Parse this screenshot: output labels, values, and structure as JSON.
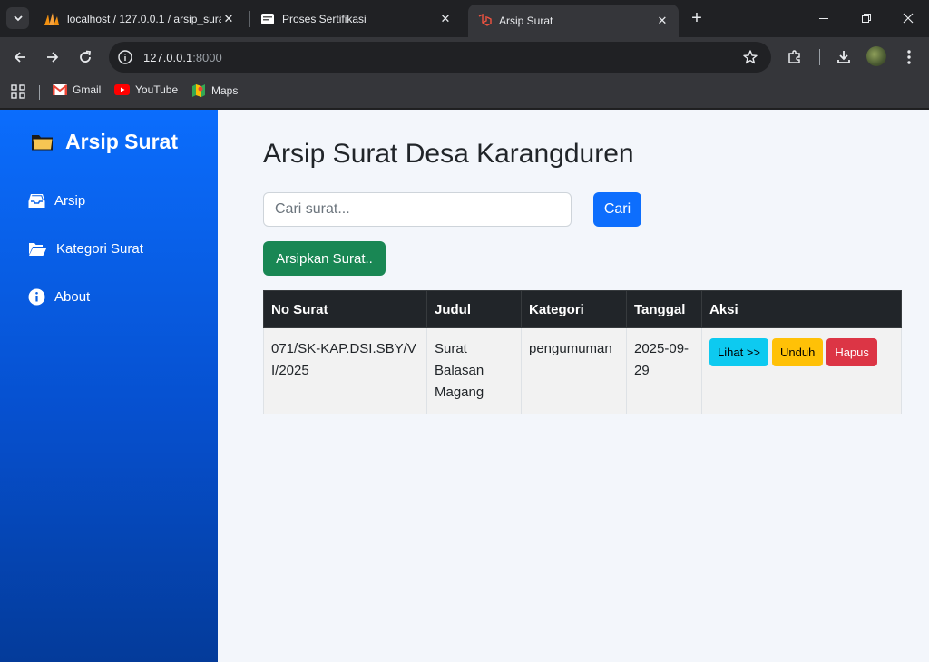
{
  "browser": {
    "tabs": [
      {
        "title": "localhost / 127.0.0.1 / arsip_surat"
      },
      {
        "title": "Proses Sertifikasi"
      },
      {
        "title": "Arsip Surat"
      }
    ],
    "url_host": "127.0.0.1",
    "url_port": ":8000",
    "bookmarks": [
      {
        "label": "Gmail"
      },
      {
        "label": "YouTube"
      },
      {
        "label": "Maps"
      }
    ]
  },
  "sidebar": {
    "brand": "Arsip Surat",
    "items": [
      {
        "label": "Arsip",
        "icon": "inbox-icon"
      },
      {
        "label": "Kategori Surat",
        "icon": "folder-open-icon"
      },
      {
        "label": "About",
        "icon": "info-icon"
      }
    ]
  },
  "main": {
    "title": "Arsip Surat Desa Karangduren",
    "search_placeholder": "Cari surat...",
    "search_button": "Cari",
    "archive_button": "Arsipkan Surat..",
    "table": {
      "headers": [
        "No Surat",
        "Judul",
        "Kategori",
        "Tanggal",
        "Aksi"
      ],
      "rows": [
        {
          "no_surat": "071/SK-KAP.DSI.SBY/VI/2025",
          "judul": "Surat Balasan Magang",
          "kategori": "pengumuman",
          "tanggal": "2025-09-29",
          "actions": {
            "view": "Lihat >>",
            "download": "Unduh",
            "delete": "Hapus"
          }
        }
      ]
    }
  },
  "colors": {
    "primary": "#0d6efd",
    "success": "#198754",
    "info": "#0dcaf0",
    "warning": "#ffc107",
    "danger": "#dc3545",
    "sidebar_top": "#0b6dfd",
    "sidebar_bottom": "#043b9a"
  }
}
